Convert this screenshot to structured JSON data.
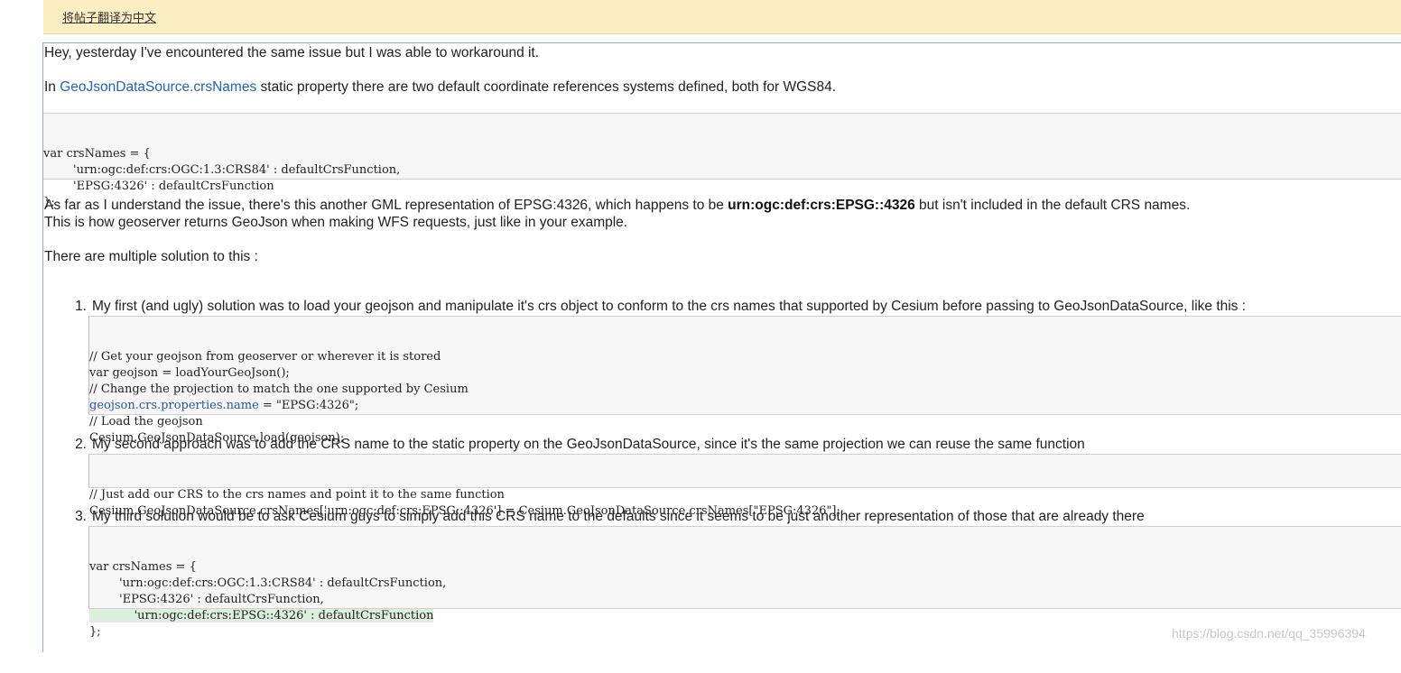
{
  "banner": {
    "translate_link": "将帖子翻译为中文"
  },
  "post": {
    "p1": "Hey, yesterday I've encountered the same issue but I was able to workaround it.",
    "p2": {
      "prefix": "In ",
      "link": "GeoJsonDataSource.crsNames",
      "suffix": " static property there are two default coordinate references systems defined, both for WGS84."
    },
    "code1": [
      "var crsNames = {",
      "        'urn:ogc:def:crs:OGC:1.3:CRS84' : defaultCrsFunction,",
      "        'EPSG:4326' : defaultCrsFunction",
      "};"
    ],
    "p3": {
      "prefix": "As far as I understand the issue, there's this another GML representation of EPSG:4326, which happens to be ",
      "bold": "urn:ogc:def:crs:EPSG::4326",
      "suffix": " but isn't included in the default CRS names."
    },
    "p4": "This is how geoserver returns GeoJson when making WFS requests, just like in your example.",
    "p5": "There are multiple solution to this :",
    "items": [
      {
        "num": "1.",
        "text": "My first (and ugly) solution was to load your geojson and manipulate it's crs object to conform to the crs names that supported by Cesium before passing to GeoJsonDataSource, like this :",
        "code": [
          "// Get your geojson from geoserver or wherever it is stored",
          "var geojson = loadYourGeoJson();",
          "// Change the projection to match the one supported by Cesium",
          "geojson.crs.properties.name",
          " = \"EPSG:4326\";",
          "// Load the geojson",
          "Cesium.GeoJsonDataSource.load(geojson);"
        ]
      },
      {
        "num": "2.",
        "text": "My second approach was to add the CRS name to the static property on the GeoJsonDataSource, since it's the same projection we can reuse the same function",
        "code": [
          "// Just add our CRS to the crs names and point it to the same function",
          "Cesium.GeoJsonDataSource.crsNames['urn:ogc:def:crs:EPSG::4326'] = Cesium.GeoJsonDataSource.crsNames[\"EPSG:4326\"];"
        ]
      },
      {
        "num": "3.",
        "text": "My third solution would be to ask Cesium guys to simply add this CRS name to the defaults since it seems to be just another representation of those that are already there",
        "code": [
          "var crsNames = {",
          "        'urn:ogc:def:crs:OGC:1.3:CRS84' : defaultCrsFunction,",
          "        'EPSG:4326' : defaultCrsFunction,",
          "            'urn:ogc:def:crs:EPSG::4326' : defaultCrsFunction",
          "};"
        ]
      }
    ]
  },
  "watermark": "https://blog.csdn.net/qq_35996394",
  "colors": {
    "banner_bg": "#fbeec2",
    "link": "#2062c9",
    "code_bg": "#f6f6f6",
    "highlight": "#dcefdc"
  }
}
